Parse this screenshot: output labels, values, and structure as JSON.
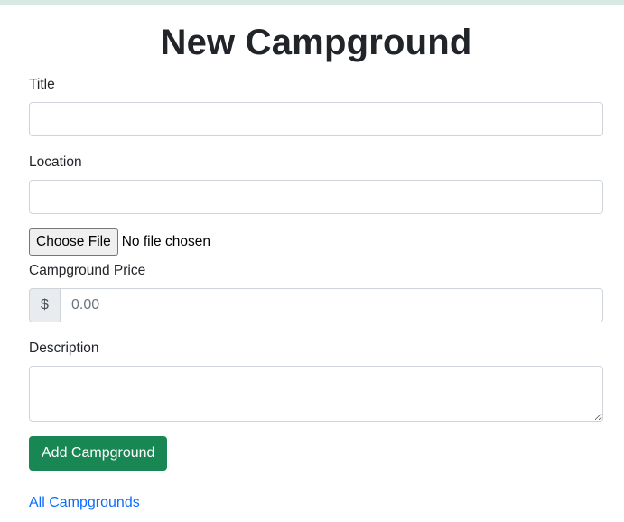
{
  "page": {
    "title": "New Campground"
  },
  "form": {
    "title_label": "Title",
    "title_value": "",
    "location_label": "Location",
    "location_value": "",
    "file_button_label": "Choose File",
    "file_status": "No file chosen",
    "price_label": "Campground Price",
    "price_prefix": "$",
    "price_placeholder": "0.00",
    "description_label": "Description",
    "description_value": "",
    "submit_label": "Add Campground"
  },
  "links": {
    "all_campgrounds": "All Campgrounds"
  },
  "colors": {
    "accent_green": "#198754",
    "link_blue": "#0d6efd",
    "top_strip": "#d7e9e4"
  }
}
